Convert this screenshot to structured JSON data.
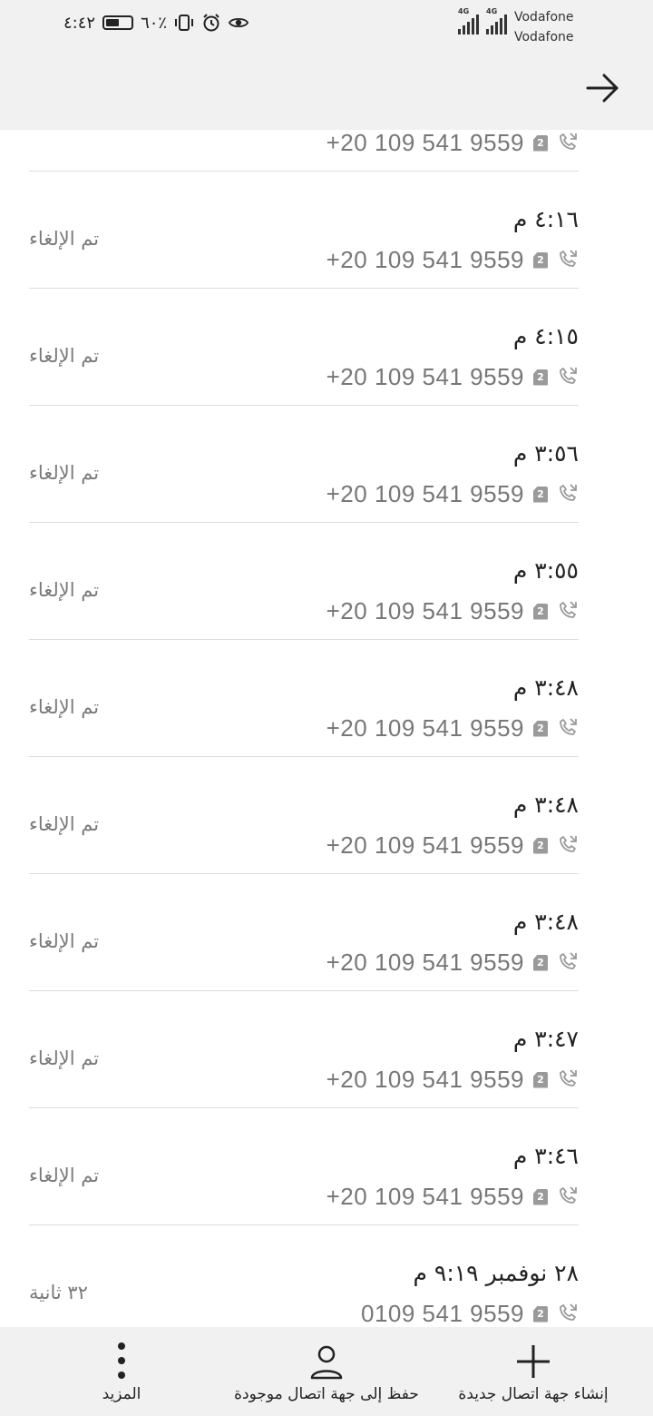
{
  "status_bar": {
    "time": "٤:٤٢",
    "battery": "٦٠٪",
    "battery_level": 0.6,
    "network_1": "4G",
    "network_2": "4G",
    "carrier_1": "Vodafone",
    "carrier_2": "Vodafone",
    "icons": [
      "battery-icon",
      "vibrate-icon",
      "alarm-icon",
      "eye-icon",
      "signal-icon"
    ]
  },
  "header": {
    "back_icon": "arrow-right-icon"
  },
  "calls": [
    {
      "time": "",
      "phone": "+20 109 541 9559",
      "status": ""
    },
    {
      "time": "٤:١٦ م",
      "phone": "+20 109 541 9559",
      "status": "تم الإلغاء"
    },
    {
      "time": "٤:١٥ م",
      "phone": "+20 109 541 9559",
      "status": "تم الإلغاء"
    },
    {
      "time": "٣:٥٦ م",
      "phone": "+20 109 541 9559",
      "status": "تم الإلغاء"
    },
    {
      "time": "٣:٥٥ م",
      "phone": "+20 109 541 9559",
      "status": "تم الإلغاء"
    },
    {
      "time": "٣:٤٨ م",
      "phone": "+20 109 541 9559",
      "status": "تم الإلغاء"
    },
    {
      "time": "٣:٤٨ م",
      "phone": "+20 109 541 9559",
      "status": "تم الإلغاء"
    },
    {
      "time": "٣:٤٨ م",
      "phone": "+20 109 541 9559",
      "status": "تم الإلغاء"
    },
    {
      "time": "٣:٤٧ م",
      "phone": "+20 109 541 9559",
      "status": "تم الإلغاء"
    },
    {
      "time": "٣:٤٦ م",
      "phone": "+20 109 541 9559",
      "status": "تم الإلغاء"
    },
    {
      "time": "٢٨ نوفمبر ٩:١٩ م",
      "phone": "0109 541 9559",
      "status": "٣٢ ثانية"
    }
  ],
  "sim_label": "2",
  "bottom_bar": {
    "create_contact": "إنشاء جهة اتصال جديدة",
    "save_existing": "حفظ إلى جهة اتصال موجودة",
    "more": "المزيد"
  }
}
